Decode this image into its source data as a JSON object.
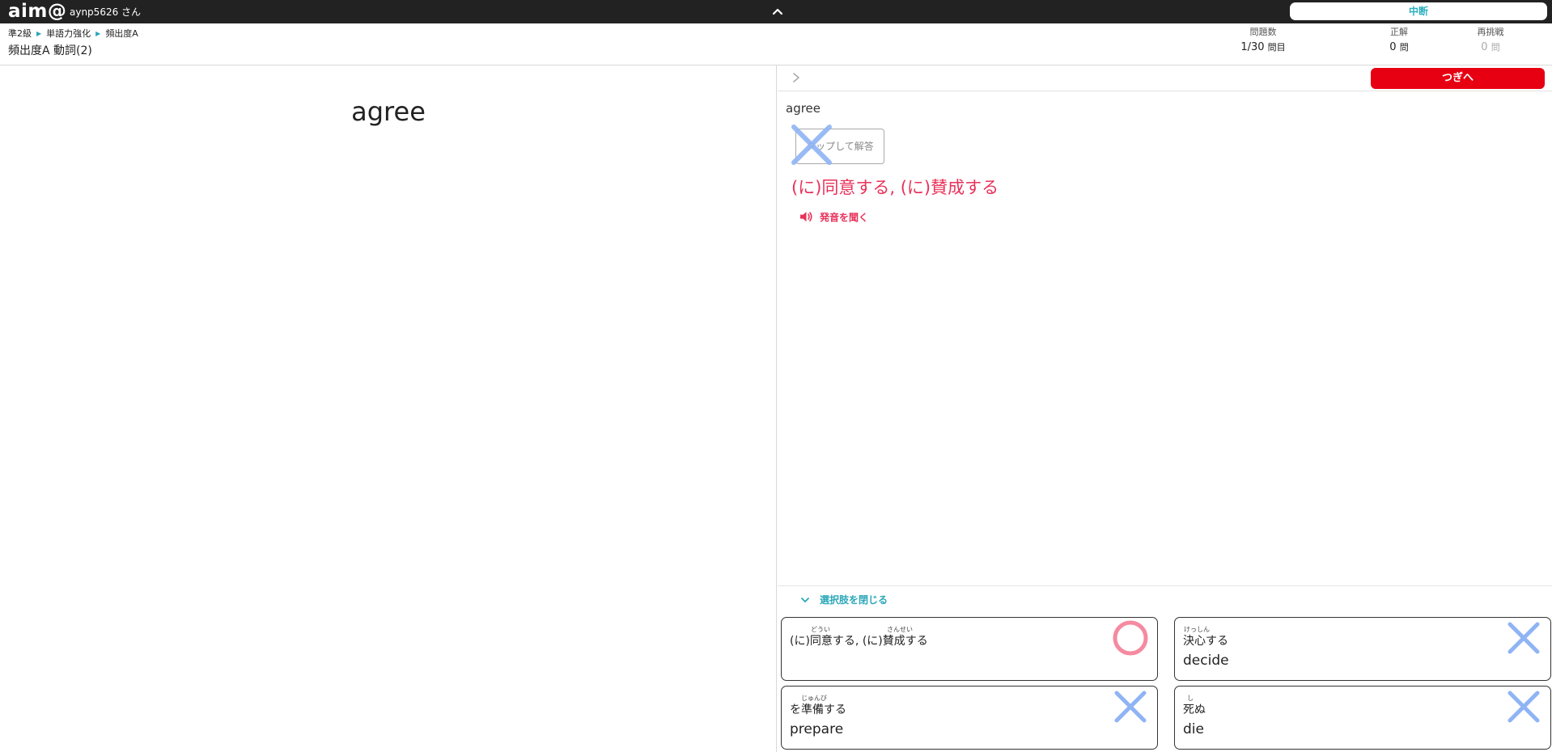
{
  "header": {
    "logo": "aim@",
    "username": "aynp5626 さん",
    "pause_label": "中断"
  },
  "breadcrumb": [
    "準2級",
    "単語力強化",
    "頻出度A"
  ],
  "page_title": "頻出度A 動詞(2)",
  "stats": {
    "questions": {
      "label": "問題数",
      "value": "1/30",
      "unit": "問目"
    },
    "correct": {
      "label": "正解",
      "value": "0",
      "unit": "問"
    },
    "retry": {
      "label": "再挑戦",
      "value": "0",
      "unit": "問"
    }
  },
  "question": {
    "word": "agree"
  },
  "answer": {
    "word": "agree",
    "tap_label": "タップして解答",
    "meaning": "(に)同意する, (に)賛成する",
    "pronunciation_label": "発音を聞く"
  },
  "toolbar": {
    "next_label": "つぎへ"
  },
  "choices_toggle": "選択肢を閉じる",
  "choices": [
    {
      "jp": "(に)同意する, (に)賛成する",
      "en": "",
      "ruby": [
        "どうい",
        "さんせい"
      ],
      "mark": "correct"
    },
    {
      "jp": "決心する",
      "en": "decide",
      "ruby": [
        "けっしん"
      ],
      "mark": "wrong"
    },
    {
      "jp": "を準備する",
      "en": "prepare",
      "ruby": [
        "じゅんび"
      ],
      "mark": "wrong"
    },
    {
      "jp": "死ぬ",
      "en": "die",
      "ruby": [
        "し"
      ],
      "mark": "wrong"
    }
  ],
  "colors": {
    "accent": "#2aa7b8",
    "next": "#e60012",
    "meaning": "#e8325a",
    "correct_mark": "#f58aa0",
    "wrong_mark": "#8fb4f5"
  }
}
